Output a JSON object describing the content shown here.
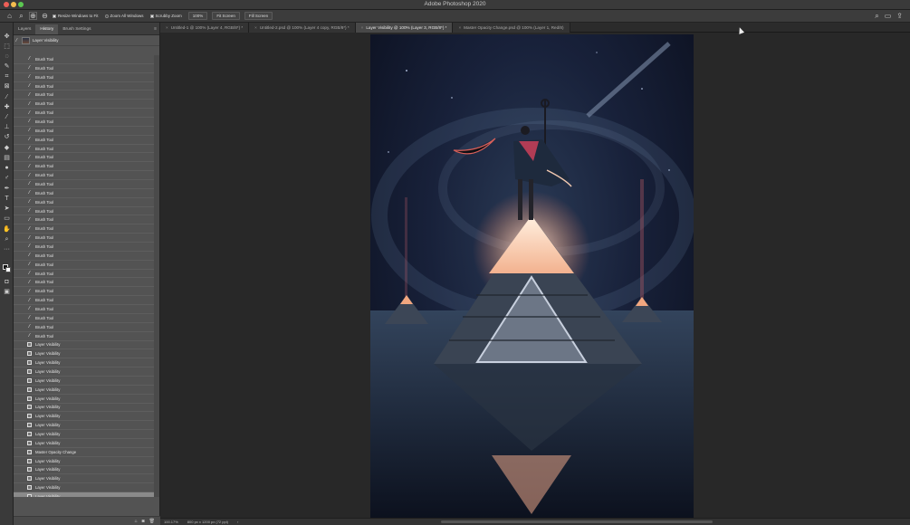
{
  "window": {
    "title": "Adobe Photoshop 2020"
  },
  "options_bar": {
    "resize_windows_label": "Resize Windows to Fit",
    "zoom_all_label": "Zoom All Windows",
    "scrubby_zoom_label": "Scrubby Zoom",
    "zoom_100_label": "100%",
    "fit_screen_label": "Fit Screen",
    "fill_screen_label": "Fill Screen"
  },
  "doc_tabs": [
    {
      "label": "Untitled-1 @ 100% (Layer 4, RGB/8*) *"
    },
    {
      "label": "Untitled-2.psd @ 100% (Layer 4 copy, RGB/8*) *"
    },
    {
      "label": "Layer Visibility @ 100% (Layer 3, RGB/8*) *"
    },
    {
      "label": "Master Opacity Change.psd @ 100% (Layer 1, Red/8)"
    }
  ],
  "panel": {
    "tabs": [
      "Layers",
      "History",
      "Brush Settings"
    ],
    "snapshot_label": "Layer Visibility",
    "history_items": [
      "Brush Tool",
      "Brush Tool",
      "Brush Tool",
      "Brush Tool",
      "Brush Tool",
      "Brush Tool",
      "Brush Tool",
      "Brush Tool",
      "Brush Tool",
      "Brush Tool",
      "Brush Tool",
      "Brush Tool",
      "Brush Tool",
      "Brush Tool",
      "Brush Tool",
      "Brush Tool",
      "Brush Tool",
      "Brush Tool",
      "Brush Tool",
      "Brush Tool",
      "Brush Tool",
      "Brush Tool",
      "Brush Tool",
      "Brush Tool",
      "Brush Tool",
      "Brush Tool",
      "Brush Tool",
      "Brush Tool",
      "Brush Tool",
      "Brush Tool",
      "Brush Tool",
      "Brush Tool",
      "Layer Visibility",
      "Layer Visibility",
      "Layer Visibility",
      "Layer Visibility",
      "Layer Visibility",
      "Layer Visibility",
      "Layer Visibility",
      "Layer Visibility",
      "Layer Visibility",
      "Layer Visibility",
      "Layer Visibility",
      "Layer Visibility",
      "Master Opacity Change",
      "Layer Visibility",
      "Layer Visibility",
      "Layer Visibility",
      "Layer Visibility",
      "Layer Visibility"
    ]
  },
  "status": {
    "zoom": "100.17%",
    "doc_size": "800 px x 1200 px (72 ppi)"
  }
}
